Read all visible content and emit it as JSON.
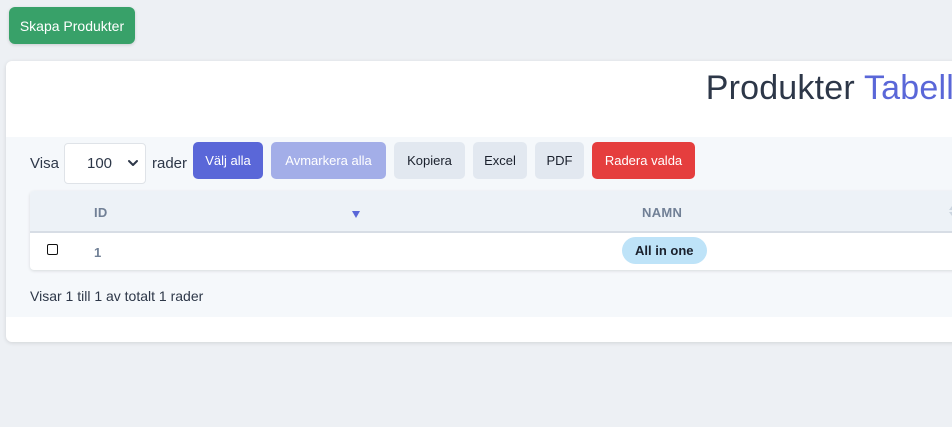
{
  "header": {
    "create_button_label": "Skapa Produkter"
  },
  "title": {
    "main": "Produkter",
    "accent": "Tabell",
    "accent_color": "#5a67d8"
  },
  "controls": {
    "show_label": "Visa",
    "rows_value": "100",
    "rows_suffix": "rader",
    "buttons": {
      "select_all": "Välj alla",
      "deselect_all": "Avmarkera alla",
      "copy": "Kopiera",
      "excel": "Excel",
      "pdf": "PDF",
      "delete_selected": "Radera valda"
    }
  },
  "table": {
    "columns": [
      "ID",
      "NAMN"
    ],
    "rows": [
      {
        "id": "1",
        "name": "All in one"
      }
    ]
  },
  "footer": {
    "info": "Visar 1 till 1 av totalt 1 rader"
  },
  "colors": {
    "create_button": "#38a169",
    "primary": "#5a67d8",
    "danger": "#e53e3e",
    "badge": "#bee3f8"
  }
}
